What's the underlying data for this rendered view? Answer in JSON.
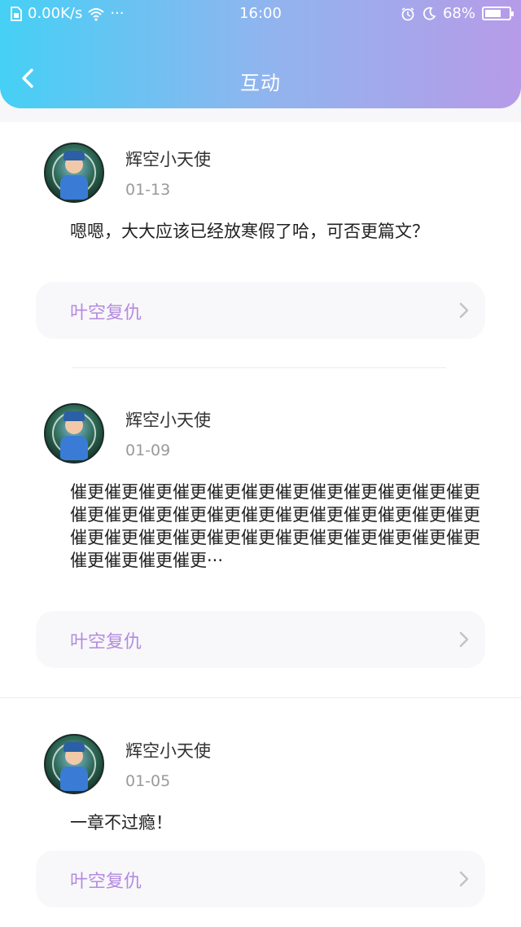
{
  "status_bar": {
    "network_speed": "0.00K/s",
    "dots": "···",
    "time": "16:00",
    "battery_percent": "68%",
    "battery_level": 0.68
  },
  "nav": {
    "title": "互动",
    "back_icon": "chevron-left-icon"
  },
  "colors": {
    "header_gradient_start": "#45d0f5",
    "header_gradient_end": "#b79be8",
    "reply_text": "#b48ae0"
  },
  "posts": [
    {
      "username": "辉空小天使",
      "date": "01-13",
      "content": "嗯嗯，大大应该已经放寒假了哈，可否更篇文？",
      "reply_target": "叶空复仇"
    },
    {
      "username": "辉空小天使",
      "date": "01-09",
      "content": "催更催更催更催更催更催更催更催更催更催更催更催更催更催更催更催更催更催更催更催更催更催更催更催更催更催更催更催更催更催更催更催更催更催更催更催更催更催更催更催更···",
      "reply_target": "叶空复仇"
    },
    {
      "username": "辉空小天使",
      "date": "01-05",
      "content": "一章不过瘾！",
      "reply_target": "叶空复仇"
    }
  ]
}
